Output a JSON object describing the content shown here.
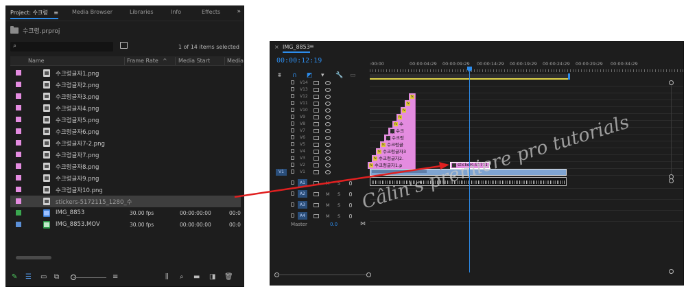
{
  "project_panel": {
    "tabs": [
      {
        "label": "Project: 수크령",
        "active": true
      },
      {
        "label": "Media Browser",
        "active": false
      },
      {
        "label": "Libraries",
        "active": false
      },
      {
        "label": "Info",
        "active": false
      },
      {
        "label": "Effects",
        "active": false
      }
    ],
    "tabs_menu_icon": "hamburger-icon",
    "more_icon": "»",
    "project_file": "수크령.prproj",
    "search_value": "",
    "item_count": "1 of 14 items selected",
    "columns": [
      "Name",
      "Frame Rate",
      "Media Start",
      "Media"
    ],
    "sort_indicator": "^",
    "items": [
      {
        "name": "수크렁글자1.png",
        "color": "#e48ce0",
        "type": "image",
        "frame_rate": "",
        "media_start": "",
        "media": "",
        "selected": false
      },
      {
        "name": "수크렁글자2.png",
        "color": "#e48ce0",
        "type": "image",
        "frame_rate": "",
        "media_start": "",
        "media": "",
        "selected": false
      },
      {
        "name": "수크렁글자3.png",
        "color": "#e48ce0",
        "type": "image",
        "frame_rate": "",
        "media_start": "",
        "media": "",
        "selected": false
      },
      {
        "name": "수크렁글자4.png",
        "color": "#e48ce0",
        "type": "image",
        "frame_rate": "",
        "media_start": "",
        "media": "",
        "selected": false
      },
      {
        "name": "수크렁글자5.png",
        "color": "#e48ce0",
        "type": "image",
        "frame_rate": "",
        "media_start": "",
        "media": "",
        "selected": false
      },
      {
        "name": "수크렁글자6.png",
        "color": "#e48ce0",
        "type": "image",
        "frame_rate": "",
        "media_start": "",
        "media": "",
        "selected": false
      },
      {
        "name": "수크렁글자7-2.png",
        "color": "#e48ce0",
        "type": "image",
        "frame_rate": "",
        "media_start": "",
        "media": "",
        "selected": false
      },
      {
        "name": "수크렁글자7.png",
        "color": "#e48ce0",
        "type": "image",
        "frame_rate": "",
        "media_start": "",
        "media": "",
        "selected": false
      },
      {
        "name": "수크렁글자8.png",
        "color": "#e48ce0",
        "type": "image",
        "frame_rate": "",
        "media_start": "",
        "media": "",
        "selected": false
      },
      {
        "name": "수크렁글자9.png",
        "color": "#e48ce0",
        "type": "image",
        "frame_rate": "",
        "media_start": "",
        "media": "",
        "selected": false
      },
      {
        "name": "수크렁글자10.png",
        "color": "#e48ce0",
        "type": "image",
        "frame_rate": "",
        "media_start": "",
        "media": "",
        "selected": false
      },
      {
        "name": "stickers-5172115_1280_수",
        "color": "#e48ce0",
        "type": "image",
        "frame_rate": "",
        "media_start": "",
        "media": "",
        "selected": true
      },
      {
        "name": "IMG_8853",
        "color": "#3aa74f",
        "type": "sequence",
        "frame_rate": "30.00 fps",
        "media_start": "00:00:00:00",
        "media": "00:0",
        "selected": false
      },
      {
        "name": "IMG_8853.MOV",
        "color": "#5b8fd6",
        "type": "movie",
        "frame_rate": "30.00 fps",
        "media_start": "00:00:00:00",
        "media": "00:0",
        "selected": false
      }
    ],
    "footer_icons": [
      "pencil-icon",
      "list-view-icon",
      "icon-view-icon",
      "freeform-view-icon",
      "zoom-slider",
      "sort-icon",
      "automate-icon",
      "find-icon",
      "new-bin-icon",
      "new-item-icon",
      "trash-icon"
    ]
  },
  "timeline_panel": {
    "close_icon": "×",
    "sequence_name": "IMG_8853",
    "menu_icon": "≡",
    "timecode": "00:00:12:19",
    "ruler_labels": [
      ":00:00",
      "00:00:04:29",
      "00:00:09:29",
      "00:00:14:29",
      "00:00:19:29",
      "00:00:24:29",
      "00:00:29:29",
      "00:00:34:29"
    ],
    "video_tracks": [
      "V14",
      "V13",
      "V12",
      "V11",
      "V10",
      "V9",
      "V8",
      "V7",
      "V6",
      "V5",
      "V4",
      "V3",
      "V2",
      "V1"
    ],
    "audio_tracks": [
      "A1",
      "A2",
      "A3",
      "A4"
    ],
    "v1_source_label": "V1",
    "audio_buttons": {
      "mute": "M",
      "solo": "S"
    },
    "master_label": "Master",
    "master_value": "0.0",
    "clips": [
      {
        "track": "V12",
        "label": ""
      },
      {
        "track": "V11",
        "label": ""
      },
      {
        "track": "V10",
        "label": ""
      },
      {
        "track": "V9",
        "label": ""
      },
      {
        "track": "V8",
        "label": "수"
      },
      {
        "track": "V7",
        "label": "수크"
      },
      {
        "track": "V6",
        "label": "수크렁"
      },
      {
        "track": "V5",
        "label": "수크렁글"
      },
      {
        "track": "V4",
        "label": "수크렁글자3"
      },
      {
        "track": "V3",
        "label": "수크렁글자2."
      },
      {
        "track": "V2",
        "label": "수크렁글자1.p"
      }
    ],
    "sticker_clip_label": "stickers-51721",
    "watermark": "Câlin's premiere pro tutorials"
  },
  "annotation": {
    "arrow_color": "#e02020"
  }
}
